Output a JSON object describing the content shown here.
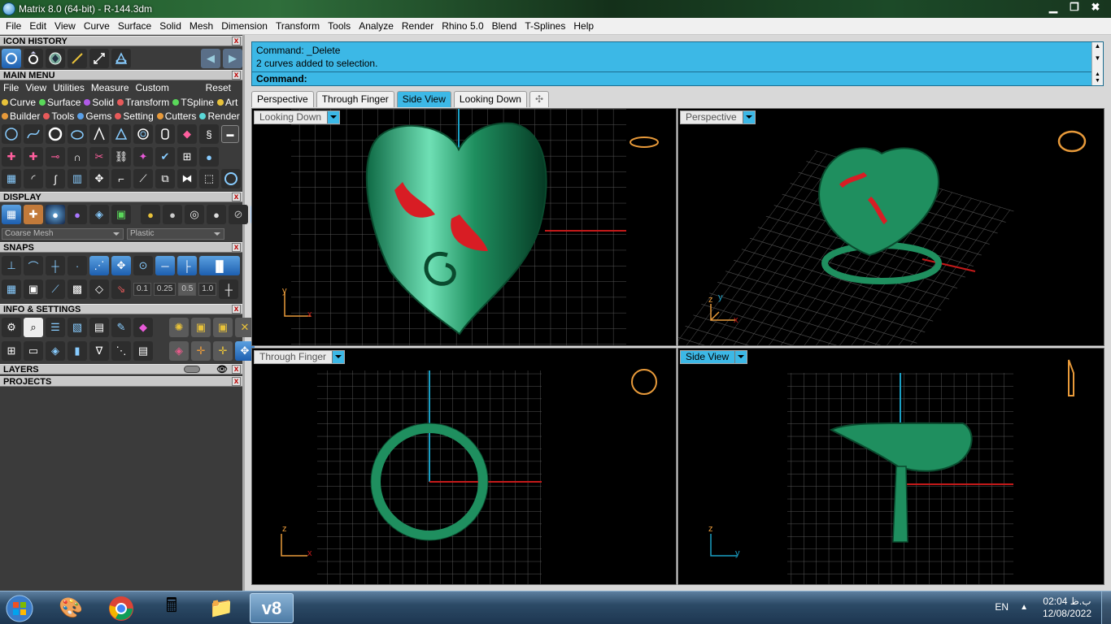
{
  "window": {
    "title": "Matrix 8.0 (64-bit) - R-144.3dm",
    "min": "▁",
    "max": "❐",
    "close": "✖"
  },
  "menu": [
    "File",
    "Edit",
    "View",
    "Curve",
    "Surface",
    "Solid",
    "Mesh",
    "Dimension",
    "Transform",
    "Tools",
    "Analyze",
    "Render",
    "Rhino 5.0",
    "Blend",
    "T-Splines",
    "Help"
  ],
  "panels": {
    "icon_history": "ICON HISTORY",
    "main_menu": "MAIN MENU",
    "display": "DISPLAY",
    "snaps": "SNAPS",
    "info_settings": "INFO & SETTINGS",
    "layers": "LAYERS",
    "projects": "PROJECTS",
    "close": "x"
  },
  "main_menu_row": [
    "File",
    "View",
    "Utilities",
    "Measure",
    "Custom"
  ],
  "reset_label": "Reset",
  "categories_row1": [
    {
      "label": "Curve",
      "color": "#e8c23a"
    },
    {
      "label": "Surface",
      "color": "#5ad85a"
    },
    {
      "label": "Solid",
      "color": "#b05ae8"
    },
    {
      "label": "Transform",
      "color": "#e85a5a"
    },
    {
      "label": "TSpline",
      "color": "#5ad85a"
    },
    {
      "label": "Art",
      "color": "#e8c23a"
    }
  ],
  "categories_row2": [
    {
      "label": "Builder",
      "color": "#e89a3a"
    },
    {
      "label": "Tools",
      "color": "#e85a5a"
    },
    {
      "label": "Gems",
      "color": "#5aa0e8"
    },
    {
      "label": "Setting",
      "color": "#e85a5a"
    },
    {
      "label": "Cutters",
      "color": "#e89a3a"
    },
    {
      "label": "Render",
      "color": "#5ad8d8"
    }
  ],
  "display_selects": {
    "mesh": "Coarse Mesh",
    "material": "Plastic"
  },
  "snap_values": [
    "0.1",
    "0.25",
    "0.5",
    "1.0"
  ],
  "command": {
    "line1": "Command: _Delete",
    "line2": "2 curves added to selection.",
    "prompt": "Command:"
  },
  "tabs": [
    "Perspective",
    "Through Finger",
    "Side View",
    "Looking Down"
  ],
  "active_tab": "Side View",
  "viewports": {
    "tl": {
      "label": "Looking Down",
      "ax1": "y",
      "ax2": "x"
    },
    "tr": {
      "label": "Perspective",
      "ax1": "z",
      "ax2": "y",
      "ax3": "x"
    },
    "bl": {
      "label": "Through Finger",
      "ax1": "z",
      "ax2": "x"
    },
    "br": {
      "label": "Side View",
      "ax1": "z",
      "ax2": "y"
    }
  },
  "taskbar": {
    "lang": "EN",
    "time": "02:04 ب.ظ",
    "date": "12/08/2022",
    "matrix_label": "v8"
  },
  "colors": {
    "accent": "#3cb8e6",
    "panel_bg": "#3b3b3b",
    "model_green": "#1f8f5f",
    "gem_red": "#d81d24",
    "axis_red": "#c41a1a",
    "axis_blue": "#1a9fc4"
  }
}
